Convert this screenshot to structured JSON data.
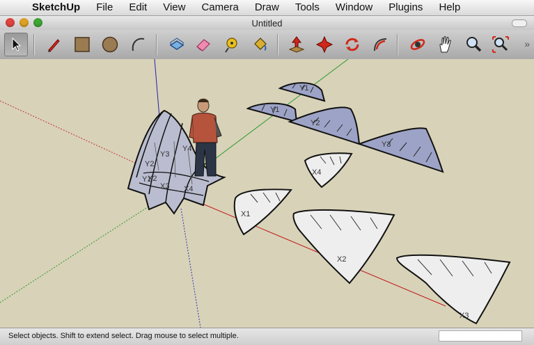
{
  "menubar": {
    "app_name": "SketchUp",
    "items": [
      "File",
      "Edit",
      "View",
      "Camera",
      "Draw",
      "Tools",
      "Window",
      "Plugins",
      "Help"
    ]
  },
  "window": {
    "title": "Untitled"
  },
  "toolbar": {
    "tools": [
      "select",
      "pencil",
      "rectangle",
      "circle",
      "arc",
      "push-pull",
      "eraser",
      "tape-measure",
      "paint-bucket",
      "move",
      "rotate-move",
      "rotate",
      "follow-me",
      "orbit",
      "pan",
      "zoom",
      "zoom-extents"
    ]
  },
  "scene": {
    "labels": {
      "y1": "Y1",
      "y2": "Y2",
      "y3": "Y3",
      "y4": "Y4",
      "x1": "X1",
      "x2": "X2",
      "x3": "X3",
      "x4": "X4",
      "c_y3": "Y3",
      "c_y4": "Y4",
      "c_y2": "Y2",
      "c_x2": "X2",
      "c_x3": "X3",
      "c_x4": "X4",
      "c_y1": "Y1"
    }
  },
  "status": {
    "text": "Select objects. Shift to extend select. Drag mouse to select multiple.",
    "measurement": ""
  }
}
